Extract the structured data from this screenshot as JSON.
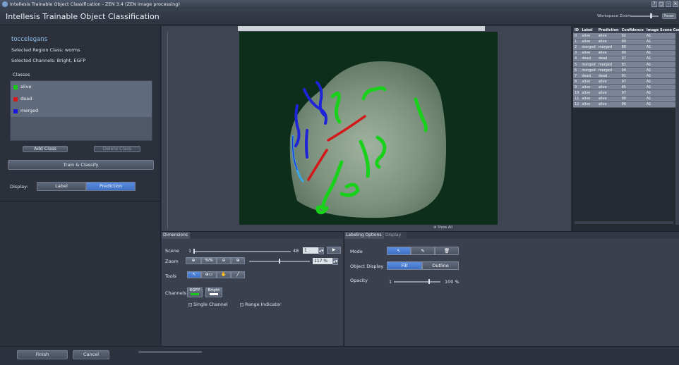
{
  "window": {
    "title": "Intellesis Trainable Object Classification - ZEN 3.4 (ZEN image processing)",
    "buttons": [
      "?",
      "▢",
      "–",
      "✕"
    ]
  },
  "header": {
    "title": "Intellesis Trainable Object Classification",
    "workspace_zoom_label": "Workspace Zoom",
    "reset_label": "Reset"
  },
  "left_panel": {
    "class_name": "toccelegans",
    "selected_region_class": "Selected Region Class: worms",
    "selected_channels": "Selected Channels: Bright, EGFP",
    "classes_label": "Classes",
    "classes": [
      {
        "name": "alive",
        "color": "#19c919"
      },
      {
        "name": "dead",
        "color": "#d81818"
      },
      {
        "name": "merged",
        "color": "#1a1ad8"
      }
    ],
    "add_class_label": "Add Class",
    "delete_class_label": "Delete Class",
    "train_classify_label": "Train & Classify",
    "display_label": "Display:",
    "display_options": [
      "Label",
      "Prediction"
    ],
    "display_selected": "Prediction"
  },
  "viewer": {
    "show_all_label": "⊕ Show All"
  },
  "table": {
    "columns": [
      "ID",
      "Label",
      "Prediction",
      "Confidence",
      "Image Scene Con"
    ],
    "rows": [
      [
        "0",
        "alive",
        "alive",
        "92",
        "A1"
      ],
      [
        "1",
        "alive",
        "alive",
        "99",
        "A1"
      ],
      [
        "2",
        "merged",
        "merged",
        "88",
        "A1"
      ],
      [
        "3",
        "alive",
        "alive",
        "99",
        "A1"
      ],
      [
        "4",
        "dead",
        "dead",
        "97",
        "A1"
      ],
      [
        "5",
        "merged",
        "merged",
        "81",
        "A1"
      ],
      [
        "6",
        "merged",
        "merged",
        "94",
        "A1"
      ],
      [
        "7",
        "dead",
        "dead",
        "91",
        "A1"
      ],
      [
        "8",
        "alive",
        "alive",
        "97",
        "A1"
      ],
      [
        "9",
        "alive",
        "alive",
        "85",
        "A1"
      ],
      [
        "10",
        "alive",
        "alive",
        "97",
        "A1"
      ],
      [
        "11",
        "alive",
        "alive",
        "98",
        "A1"
      ],
      [
        "12",
        "alive",
        "alive",
        "96",
        "A1"
      ]
    ]
  },
  "dimensions": {
    "tab_label": "Dimensions",
    "scene_label": "Scene",
    "scene_min": "1",
    "scene_max": "48",
    "scene_value": "1",
    "zoom_label": "Zoom",
    "zoom_fit_label": "%%",
    "zoom_value": "117 %",
    "tools_label": "Tools",
    "channels_label": "Channels",
    "channels": [
      {
        "name": "EGFP",
        "color": "#19c919"
      },
      {
        "name": "Bright",
        "color": "#ffffff"
      }
    ],
    "single_channel_label": "Single Channel",
    "range_indicator_label": "Range Indicator"
  },
  "labeling": {
    "tab_label": "Labeling Options",
    "display_tab_label": "Display",
    "mode_label": "Mode",
    "object_display_label": "Object Display",
    "object_display_options": [
      "Fill",
      "Outline"
    ],
    "object_display_selected": "Fill",
    "opacity_label": "Opacity",
    "opacity_min": "1",
    "opacity_value": "100 %"
  },
  "footer": {
    "finish_label": "Finish",
    "cancel_label": "Cancel"
  }
}
